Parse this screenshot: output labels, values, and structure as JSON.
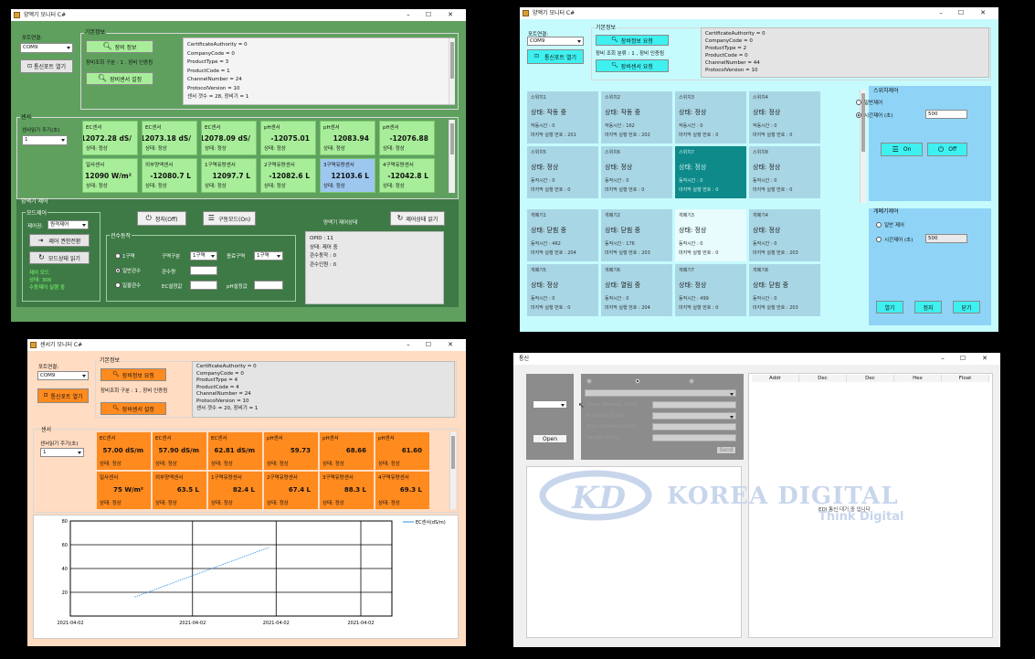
{
  "w1": {
    "title": "양액기 모니터 C#",
    "port_label": "포트연결:",
    "port": "COM9",
    "connect": "통신포트 열기",
    "basic": "기본정보",
    "req_info": "장비 정보",
    "status_text": "장비조회 구분 : 1 , 장비 인증됨",
    "req_sensor": "장비센서 설정",
    "props": [
      "CertificateAuthority = 0",
      "CompanyCode = 0",
      "ProductType = 3",
      "ProductCode = 1",
      "ChannelNumber = 24",
      "ProtocolVersion = 10",
      "센서 갯수 = 28, 장비기 = 1"
    ],
    "sensor_grp": "센서",
    "interval_label": "센서읽기 주기(초)",
    "interval": "1",
    "cards": [
      {
        "t": "EC센서",
        "v": "12072.28 dS/",
        "s": "상태: 정상",
        "bg": "#a8ee9a"
      },
      {
        "t": "EC센서",
        "v": "-12073.18 dS/",
        "s": "상태: 정상",
        "bg": "#a8ee9a"
      },
      {
        "t": "EC센서",
        "v": "12078.09 dS/",
        "s": "상태: 정상",
        "bg": "#a8ee9a"
      },
      {
        "t": "pH센서",
        "v": "-12075.01",
        "s": "상태: 정상",
        "bg": "#a8ee9a"
      },
      {
        "t": "pH센서",
        "v": "12083.94",
        "s": "상태: 정상",
        "bg": "#a8ee9a"
      },
      {
        "t": "pH센서",
        "v": "-12076.88",
        "s": "상태: 정상",
        "bg": "#a8ee9a"
      },
      {
        "t": "일사센서",
        "v": "12090 W/m²",
        "s": "상태: 정상",
        "bg": "#a8ee9a"
      },
      {
        "t": "외부양액센서",
        "v": "-12080.7 L",
        "s": "상태: 정상",
        "bg": "#a8ee9a"
      },
      {
        "t": "1구역유량센서",
        "v": "12097.7 L",
        "s": "상태: 정상",
        "bg": "#a8ee9a"
      },
      {
        "t": "2구역유량센서",
        "v": "-12082.6 L",
        "s": "상태: 정상",
        "bg": "#a8ee9a"
      },
      {
        "t": "3구역유량센서",
        "v": "12103.6 L",
        "s": "상태: 정상",
        "bg": "#9ec7f0"
      },
      {
        "t": "4구역유량센서",
        "v": "-12042.8 L",
        "s": "상태: 정상",
        "bg": "#a8ee9a"
      }
    ],
    "ctl_grp": "양액기 제어",
    "mode_grp": "모드제어",
    "ctl_label": "제어권:",
    "ctl_mode": "원격제어",
    "ctl_btn": "제어 권한전환",
    "mode_btn": "모드상태 읽기",
    "green": [
      "제어 모드",
      "상태: 300",
      "수동제어 실행 중"
    ],
    "off_btn": "정지(Off)",
    "run_btn": "구동모드(On)",
    "refresh_btn": "제어상태 읽기",
    "cmd_grp": "관수동작",
    "r1": "1구역",
    "rl": [
      "구역구분",
      "관수량",
      "EC설정값"
    ],
    "r2": "일반관수",
    "r3": "일괄관수",
    "zone": "1구역",
    "zone2_lbl": "종료구역",
    "zone2": "1구역",
    "ph_lbl": "pH설정값",
    "status_grp": "양액기 제어상태",
    "status_lines": [
      "OPID : 11",
      "상태: 제어 중",
      "관수동작 : 0",
      "관수인원 : 0"
    ]
  },
  "w2": {
    "title": "양액기 모니터 C#",
    "port_label": "포트연결:",
    "port": "COM9",
    "connect": "통신포트 열기",
    "basic": "기본정보",
    "req_info": "장비정보 요청",
    "status_text": "장비 조회 분류 : 1 , 장비 인증됨",
    "req_sensor": "장비센서 요청",
    "props": [
      "CertificateAuthority = 0",
      "CompanyCode = 0",
      "ProductType = 2",
      "ProductCode = 0",
      "ChannelNumber = 44",
      "ProtocolVersion = 10"
    ],
    "cells_top": [
      {
        "t": "스위치1",
        "s": "상태: 작동 중",
        "a": "작동시간 : 0",
        "b": "마지막 실행 번호 : 201",
        "bg": "#a9d6e5"
      },
      {
        "t": "스위치2",
        "s": "상태: 작동 중",
        "a": "작동시간 : 162",
        "b": "마지막 실행 번호 : 202",
        "bg": "#a9d6e5"
      },
      {
        "t": "스위치3",
        "s": "상태: 정상",
        "a": "작동시간 : 0",
        "b": "마지막 실행 번호 : 0",
        "bg": "#a9d6e5"
      },
      {
        "t": "스위치4",
        "s": "상태: 정상",
        "a": "작동시간 : 0",
        "b": "마지막 실행 번호 : 0",
        "bg": "#a9d6e5"
      },
      {
        "t": "스위치5",
        "s": "상태: 정상",
        "a": "동작시간 : 0",
        "b": "마지막 실행 번호 : 0",
        "bg": "#a9d6e5"
      },
      {
        "t": "스위치6",
        "s": "상태: 정상",
        "a": "동작시간 : 0",
        "b": "마지막 실행 번호 : 0",
        "bg": "#a9d6e5"
      },
      {
        "t": "스위치7",
        "s": "상태: 정상",
        "a": "동작시간 : 0",
        "b": "마지막 실행 번호 : 0",
        "bg": "#0e8a8a"
      },
      {
        "t": "스위치8",
        "s": "상태: 정상",
        "a": "동작시간 : 0",
        "b": "마지막 실행 번호 : 0",
        "bg": "#a9d6e5"
      }
    ],
    "cells_bot": [
      {
        "t": "개폐기1",
        "s": "상태: 닫힘 중",
        "a": "동작시간 : 462",
        "b": "마지막 실행 번호 : 204",
        "bg": "#a9d6e5"
      },
      {
        "t": "개폐기2",
        "s": "상태: 닫힘 중",
        "a": "동작시간 : 176",
        "b": "마지막 실행 번호 : 203",
        "bg": "#a9d6e5"
      },
      {
        "t": "개폐기3",
        "s": "상태: 정상",
        "a": "동작시간 : 0",
        "b": "마지막 실행 번호 : 0",
        "bg": "#e8fbfd"
      },
      {
        "t": "개폐기4",
        "s": "상태: 정상",
        "a": "동작시간 : 0",
        "b": "마지막 실행 번호 : 203",
        "bg": "#a9d6e5"
      },
      {
        "t": "개폐기5",
        "s": "상태: 정상",
        "a": "동작시간 : 0",
        "b": "마지막 실행 번호 : 0",
        "bg": "#a9d6e5"
      },
      {
        "t": "개폐기6",
        "s": "상태: 열림 중",
        "a": "동작시간 : 0",
        "b": "마지막 실행 번호 : 204",
        "bg": "#a9d6e5"
      },
      {
        "t": "개폐기7",
        "s": "상태: 정상",
        "a": "동작시간 : 499",
        "b": "마지막 실행 번호 : 0",
        "bg": "#a9d6e5"
      },
      {
        "t": "개폐기8",
        "s": "상태: 닫힘 중",
        "a": "동작시간 : 0",
        "b": "마지막 실행 번호 : 203",
        "bg": "#a9d6e5"
      }
    ],
    "sw_grp": "스위치제어",
    "r_normal": "일반제어",
    "r_time": "시간제어 (초)",
    "time_val": "500",
    "on": "On",
    "off": "Off",
    "op_grp": "개폐기제어",
    "r2_normal": "일반 제어",
    "r2_time": "시간제어 (초)",
    "time2_val": "500",
    "b_open": "열기",
    "b_stop": "정지",
    "b_close": "닫기"
  },
  "w3": {
    "title": "센서기 모니터 C#",
    "port_label": "포트연결:",
    "port": "COM9",
    "connect": "통신포트 열기",
    "basic": "기본정보",
    "req_info": "장비정보 요청",
    "status_text": "장비조회 구분 : 1 , 장비 인증됨",
    "req_sensor": "장비센서 설정",
    "props": [
      "CertificateAuthority = 0",
      "CompanyCode = 0",
      "ProductType = 4",
      "ProductCode = 4",
      "ChannelNumber = 24",
      "ProtocolVersion = 10",
      "센서 갯수 = 20, 장비기 = 1"
    ],
    "sensor_grp": "센서",
    "interval_label": "센서읽기 주기(초)",
    "interval": "1",
    "cards": [
      {
        "t": "EC센서",
        "v": "57.00 dS/m",
        "s": "상태: 정상"
      },
      {
        "t": "EC센서",
        "v": "57.90 dS/m",
        "s": "상태: 정상"
      },
      {
        "t": "EC센서",
        "v": "62.81 dS/m",
        "s": "상태: 정상"
      },
      {
        "t": "pH센서",
        "v": "59.73",
        "s": "상태: 정상"
      },
      {
        "t": "pH센서",
        "v": "68.66",
        "s": "상태: 정상"
      },
      {
        "t": "pH센서",
        "v": "61.60",
        "s": "상태: 정상"
      },
      {
        "t": "일사센서",
        "v": "75 W/m²",
        "s": "상태: 정상"
      },
      {
        "t": "외부양액센서",
        "v": "63.5 L",
        "s": "상태: 정상"
      },
      {
        "t": "1구역유량센서",
        "v": "82.4 L",
        "s": "상태: 정상"
      },
      {
        "t": "2구역유량센서",
        "v": "67.4 L",
        "s": "상태: 정상"
      },
      {
        "t": "3구역유량센서",
        "v": "88.3 L",
        "s": "상태: 정상"
      },
      {
        "t": "4구역유량센서",
        "v": "69.3 L",
        "s": "상태: 정상"
      }
    ],
    "chart_data": {
      "type": "line",
      "series": [
        {
          "name": "EC센서(dS/m)",
          "x": [
            0.2,
            0.62
          ],
          "y": [
            16,
            58
          ]
        }
      ],
      "ylim": [
        0,
        80
      ],
      "y_ticks": [
        "80",
        "60",
        "40",
        "20"
      ],
      "x_ticks": [
        "2021-04-02",
        "2021-04-02",
        "2021-04-02",
        "2021-04-02"
      ]
    }
  },
  "w4": {
    "title": "통신",
    "radios": [
      "",
      "",
      ""
    ],
    "open": "Open",
    "labels": [
      "Slave Address (Unit)",
      "Function (Code)",
      "Start Address (Unit)",
      "Length (Unit)"
    ],
    "send": "Send",
    "cols": [
      "Addr",
      "Dec",
      "Dec",
      "Hex",
      "Float"
    ],
    "logo1": "KOREA DIGITAL",
    "logo2": "Think Digital",
    "center_text": "EDI 통신 대기 중 입니다"
  }
}
